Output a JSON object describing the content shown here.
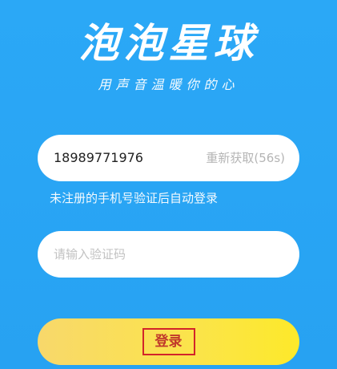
{
  "app": {
    "logo_text": "泡泡星球",
    "slogan": "用声音温暖你的心"
  },
  "phone": {
    "value": "18989771976",
    "resend_label": "重新获取(56s)"
  },
  "hint": "未注册的手机号验证后自动登录",
  "code": {
    "placeholder": "请输入验证码",
    "value": ""
  },
  "login": {
    "label": "登录"
  },
  "colors": {
    "background": "#2aa6f4",
    "button_gradient_start": "#f8d86b",
    "button_gradient_end": "#fde92a",
    "highlight_border": "#d2242a"
  }
}
